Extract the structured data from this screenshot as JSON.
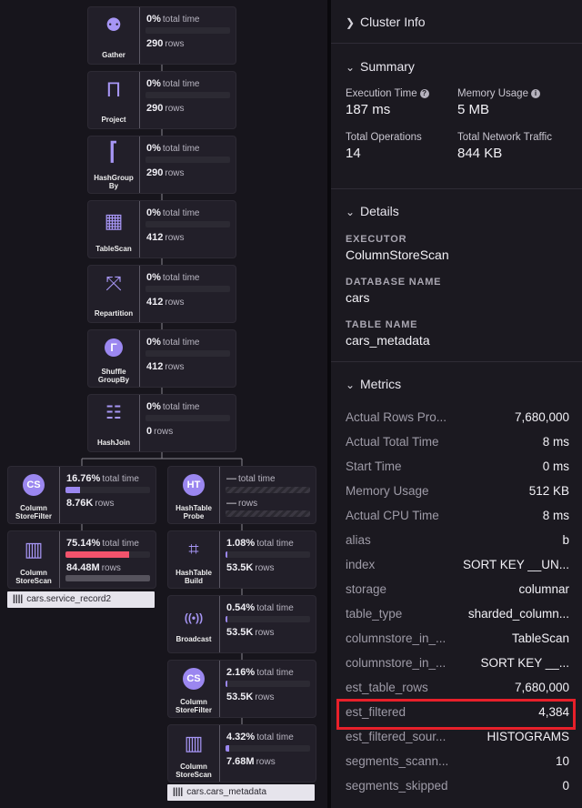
{
  "plan": {
    "nodes": [
      {
        "id": "gather",
        "label": "Gather",
        "icon": "gather-icon",
        "glyph": "⚉",
        "pct": "0%",
        "rows": "290"
      },
      {
        "id": "project",
        "label": "Project",
        "icon": "project-icon",
        "glyph": "Π",
        "pct": "0%",
        "rows": "290"
      },
      {
        "id": "hashgroupby",
        "label": "HashGroup By",
        "icon": "hashgroup-icon",
        "glyph": "⌈",
        "pct": "0%",
        "rows": "290"
      },
      {
        "id": "tablescan",
        "label": "TableScan",
        "icon": "table-icon",
        "glyph": "▦",
        "pct": "0%",
        "rows": "412"
      },
      {
        "id": "repartition",
        "label": "Repartition",
        "icon": "repartition-icon",
        "glyph": "⤧",
        "pct": "0%",
        "rows": "412"
      },
      {
        "id": "shufflegroupby",
        "label": "Shuffle GroupBy",
        "icon": "shuffle-icon",
        "glyph": "Γ",
        "pct": "0%",
        "rows": "412"
      },
      {
        "id": "hashjoin",
        "label": "HashJoin",
        "icon": "hashjoin-icon",
        "glyph": "☷",
        "pct": "0%",
        "rows": "0"
      },
      {
        "id": "csf1",
        "label": "Column StoreFilter",
        "icon": "cs-icon",
        "glyph": "CS",
        "pct": "16.76%",
        "rows": "8.76K",
        "time_fraction": 0.1676
      },
      {
        "id": "css1",
        "label": "Column StoreScan",
        "icon": "columnstore-icon",
        "glyph": "▥",
        "pct": "75.14%",
        "rows": "84.48M",
        "time_fraction": 0.7514
      },
      {
        "id": "htprobe",
        "label": "HashTable Probe",
        "icon": "ht-icon",
        "glyph": "HT",
        "pct": "—",
        "rows": "—"
      },
      {
        "id": "htbuild",
        "label": "HashTable Build",
        "icon": "hashtable-build-icon",
        "glyph": "⌗",
        "pct": "1.08%",
        "rows": "53.5K",
        "time_fraction": 0.0108
      },
      {
        "id": "broadcast",
        "label": "Broadcast",
        "icon": "broadcast-icon",
        "glyph": "((•))",
        "pct": "0.54%",
        "rows": "53.5K",
        "time_fraction": 0.0054
      },
      {
        "id": "csf2",
        "label": "Column StoreFilter",
        "icon": "cs-icon",
        "glyph": "CS",
        "pct": "2.16%",
        "rows": "53.5K",
        "time_fraction": 0.0216
      },
      {
        "id": "css2",
        "label": "Column StoreScan",
        "icon": "columnstore-icon",
        "glyph": "▥",
        "pct": "4.32%",
        "rows": "7.68M",
        "time_fraction": 0.0432
      }
    ],
    "total_time_label": "total time",
    "rows_label": "rows",
    "tags": [
      "cars.service_record2",
      "cars.cars_metadata"
    ]
  },
  "panel": {
    "cluster_info": "Cluster Info",
    "summary": {
      "title": "Summary",
      "execution_time_label": "Execution Time",
      "execution_time": "187 ms",
      "memory_usage_label": "Memory Usage",
      "memory_usage": "5 MB",
      "total_operations_label": "Total Operations",
      "total_operations": "14",
      "total_network_label": "Total Network Traffic",
      "total_network": "844 KB"
    },
    "details": {
      "title": "Details",
      "executor_label": "EXECUTOR",
      "executor": "ColumnStoreScan",
      "database_label": "DATABASE NAME",
      "database": "cars",
      "table_label": "TABLE NAME",
      "table": "cars_metadata"
    },
    "metrics": {
      "title": "Metrics",
      "rows": [
        {
          "k": "Actual Rows Pro...",
          "v": "7,680,000"
        },
        {
          "k": "Actual Total Time",
          "v": "8 ms"
        },
        {
          "k": "Start Time",
          "v": "0 ms"
        },
        {
          "k": "Memory Usage",
          "v": "512 KB"
        },
        {
          "k": "Actual CPU Time",
          "v": "8 ms"
        },
        {
          "k": "alias",
          "v": "b"
        },
        {
          "k": "index",
          "v": "SORT KEY __UN..."
        },
        {
          "k": "storage",
          "v": "columnar"
        },
        {
          "k": "table_type",
          "v": "sharded_column..."
        },
        {
          "k": "columnstore_in_...",
          "v": "TableScan"
        },
        {
          "k": "columnstore_in_...",
          "v": "SORT KEY __..."
        },
        {
          "k": "est_table_rows",
          "v": "7,680,000"
        },
        {
          "k": "est_filtered",
          "v": "4,384"
        },
        {
          "k": "est_filtered_sour...",
          "v": "HISTOGRAMS"
        },
        {
          "k": "segments_scann...",
          "v": "10"
        },
        {
          "k": "segments_skipped",
          "v": "0"
        }
      ]
    },
    "colors": {
      "accent": "#9b87f0",
      "hot": "#f2536c",
      "highlight": "#e8202a"
    }
  }
}
